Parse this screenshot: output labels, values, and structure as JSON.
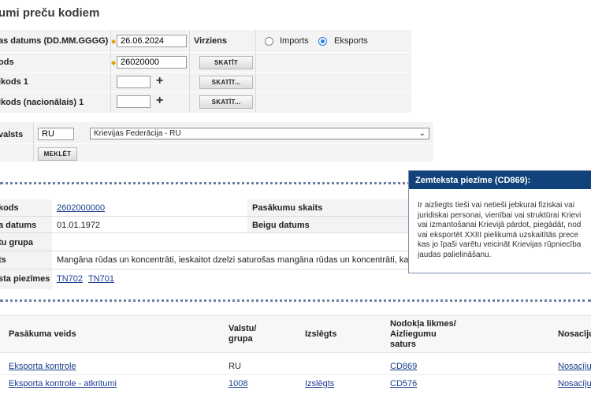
{
  "page_title": "umi preču kodiem",
  "form": {
    "date_label": "as datums (DD.MM.GGGG)",
    "date_value": "26.06.2024",
    "direction_label": "Virziens",
    "import_label": "Imports",
    "export_label": "Eksports",
    "direction_selected": "Eksports",
    "code_label": "ods",
    "code_value": "26020000",
    "show_label": "SKATĪT",
    "addcode1_label": "ikods 1",
    "addcode_nat_label": "ikods (nacionālais) 1",
    "show_more_label": "SKATĪT...",
    "country_label": "valsts",
    "country_code": "RU",
    "country_name": "Krievijas Federācija - RU",
    "search_label": "MEKLĒT"
  },
  "details": {
    "code_label": "kods",
    "code_value": "2602000000",
    "measures_count_label": "Pasākumu skaits",
    "start_date_label": "a datums",
    "start_date_value": "01.01.1972",
    "end_date_label": "Beigu datums",
    "group_label": "tu grupa",
    "desc_label": "ts",
    "desc_value": "Mangāna rūdas un koncentrāti, ieskaitot dzelzi saturošas mangāna rūdas un koncentrāti, kas sa",
    "footnotes_label": "sta piezīmes",
    "footnote_1": "TN702",
    "footnote_2": "TN701"
  },
  "popup": {
    "title": "Zemteksta piezīme (CD869):",
    "lines": [
      "Ir aizliegts tieši vai netieši jebkurai fiziskai vai",
      "juridiskai personai, vienībai vai struktūrai Krievi",
      "vai izmantošanai Krievijā pārdot, piegādāt, nod",
      "vai eksportēt XXIII pielikumā uzskaitītās prece",
      "kas jo īpaši varētu veicināt Krievijas rūpniecība",
      "jaudas palielināšanu."
    ]
  },
  "measures_table": {
    "headers": {
      "type": "Pasākuma veids",
      "country_1": "Valstu/",
      "country_2": "grupa",
      "excluded": "Izslēgts",
      "duty_1": "Nodokļa likmes/",
      "duty_2": "Aizliegumu",
      "duty_3": "saturs",
      "conditions": "Nosacīju"
    },
    "rows": [
      {
        "type": "Eksporta kontrole",
        "country": "RU",
        "excluded": "",
        "duty": "CD869",
        "conditions": "Nosacīju"
      },
      {
        "type": "Eksporta kontrole - atkritumi",
        "country": "1008",
        "excluded": "Izslēgts",
        "duty": "CD576",
        "conditions": "Nosacīju"
      }
    ]
  }
}
